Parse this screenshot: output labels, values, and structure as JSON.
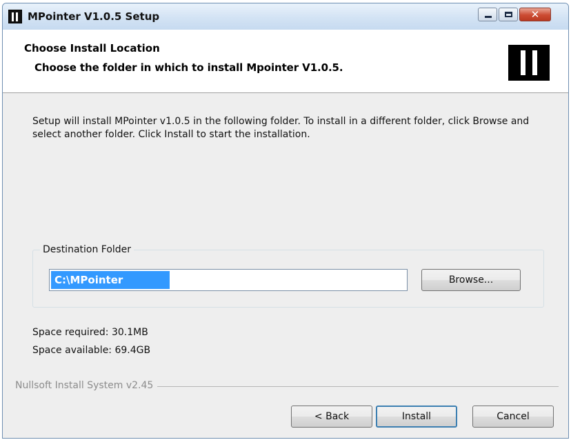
{
  "window": {
    "title": "MPointer V1.0.5 Setup",
    "close_glyph": "✕"
  },
  "header": {
    "title": "Choose Install Location",
    "subtitle": "Choose the folder in which to install Mpointer V1.0.5."
  },
  "body": {
    "description": "Setup will install MPointer v1.0.5  in the following folder. To install in a different folder, click Browse and select another folder. Click Install to start the installation.",
    "destination_group_label": "Destination Folder",
    "destination_path": "C:\\MPointer",
    "browse_label": "Browse...",
    "space_required": "Space required: 30.1MB",
    "space_available": "Space available: 69.4GB"
  },
  "footer": {
    "branding": "Nullsoft Install System v2.45",
    "back_label": "< Back",
    "install_label": "Install",
    "cancel_label": "Cancel"
  },
  "colors": {
    "selection": "#3399ff",
    "close_button": "#cc4b32",
    "title_bar": "#d3e3f4",
    "default_button_border": "#3c7fb1"
  }
}
